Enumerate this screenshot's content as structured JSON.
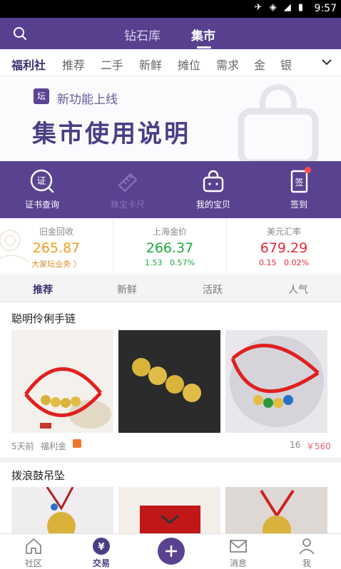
{
  "status": {
    "time": "9:57",
    "icons": "✈ ◈ ◢ ▮"
  },
  "header": {
    "tabs": [
      "钻石库",
      "集市"
    ],
    "active_tab": 1
  },
  "categories": [
    "福利社",
    "推荐",
    "二手",
    "新鲜",
    "摊位",
    "需求",
    "金",
    "银"
  ],
  "banner": {
    "badge": "坛",
    "subtitle": "新功能上线",
    "title": "集市使用说明"
  },
  "actions": [
    {
      "label": "证书查询",
      "icon": "certificate-icon"
    },
    {
      "label": "珠宝卡尺",
      "icon": "ruler-icon"
    },
    {
      "label": "我的宝贝",
      "icon": "bag-icon"
    },
    {
      "label": "签到",
      "icon": "signin-icon"
    }
  ],
  "prices": [
    {
      "label": "旧金回收",
      "value": "265.87",
      "sub": "大家坛业务 〉",
      "color": "#f29a1c"
    },
    {
      "label": "上海金价",
      "value": "266.37",
      "sub1": "1.53",
      "sub2": "0.57%",
      "color": "#19a83a"
    },
    {
      "label": "美元汇率",
      "value": "679.29",
      "sub1": "0.15",
      "sub2": "0.02%",
      "color": "#e5293a"
    }
  ],
  "subtabs": [
    "推荐",
    "新鲜",
    "活跃",
    "人气"
  ],
  "posts": [
    {
      "title": "聪明伶俐手链",
      "time": "5天前",
      "category": "福利金",
      "count": "16",
      "price": "￥560"
    },
    {
      "title": "拨浪鼓吊坠"
    }
  ],
  "tabbar": [
    "社区",
    "交易",
    "消息",
    "我"
  ],
  "colors": {
    "brand": "#58408e",
    "accent": "#5a4291"
  }
}
